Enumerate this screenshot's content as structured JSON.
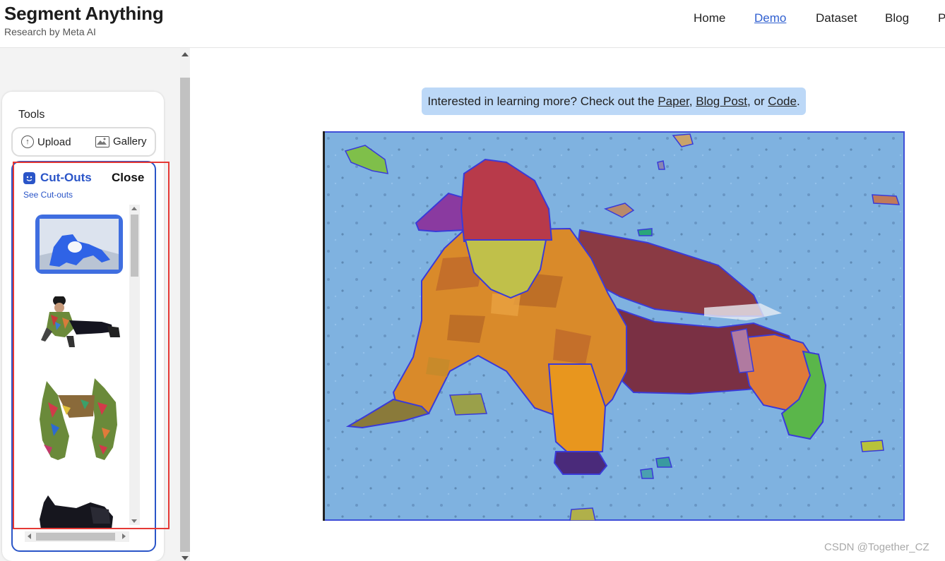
{
  "header": {
    "brand_title": "Segment Anything",
    "brand_subtitle": "Research by Meta AI",
    "nav": [
      {
        "label": "Home",
        "active": false
      },
      {
        "label": "Demo",
        "active": true
      },
      {
        "label": "Dataset",
        "active": false
      },
      {
        "label": "Blog",
        "active": false
      },
      {
        "label": "Pa",
        "active": false
      }
    ]
  },
  "sidebar": {
    "tools_label": "Tools",
    "upload_label": "Upload",
    "gallery_label": "Gallery",
    "cutouts": {
      "title": "Cut-Outs",
      "close_label": "Close",
      "see_link": "See Cut-outs",
      "items": [
        "cutout-full-image",
        "cutout-person",
        "cutout-jacket",
        "cutout-pants"
      ]
    }
  },
  "main": {
    "info_prefix": "Interested in learning more? Check out the ",
    "info_link_paper": "Paper",
    "info_sep1": ", ",
    "info_link_blog": "Blog Post",
    "info_sep2": ", or ",
    "info_link_code": "Code",
    "info_suffix": "."
  },
  "watermark": "CSDN @Together_CZ",
  "colors": {
    "accent": "#2a55c8",
    "highlight_box": "#e53935",
    "info_bg": "#bcd8f7",
    "mask_snow": "#7fb2e0"
  }
}
